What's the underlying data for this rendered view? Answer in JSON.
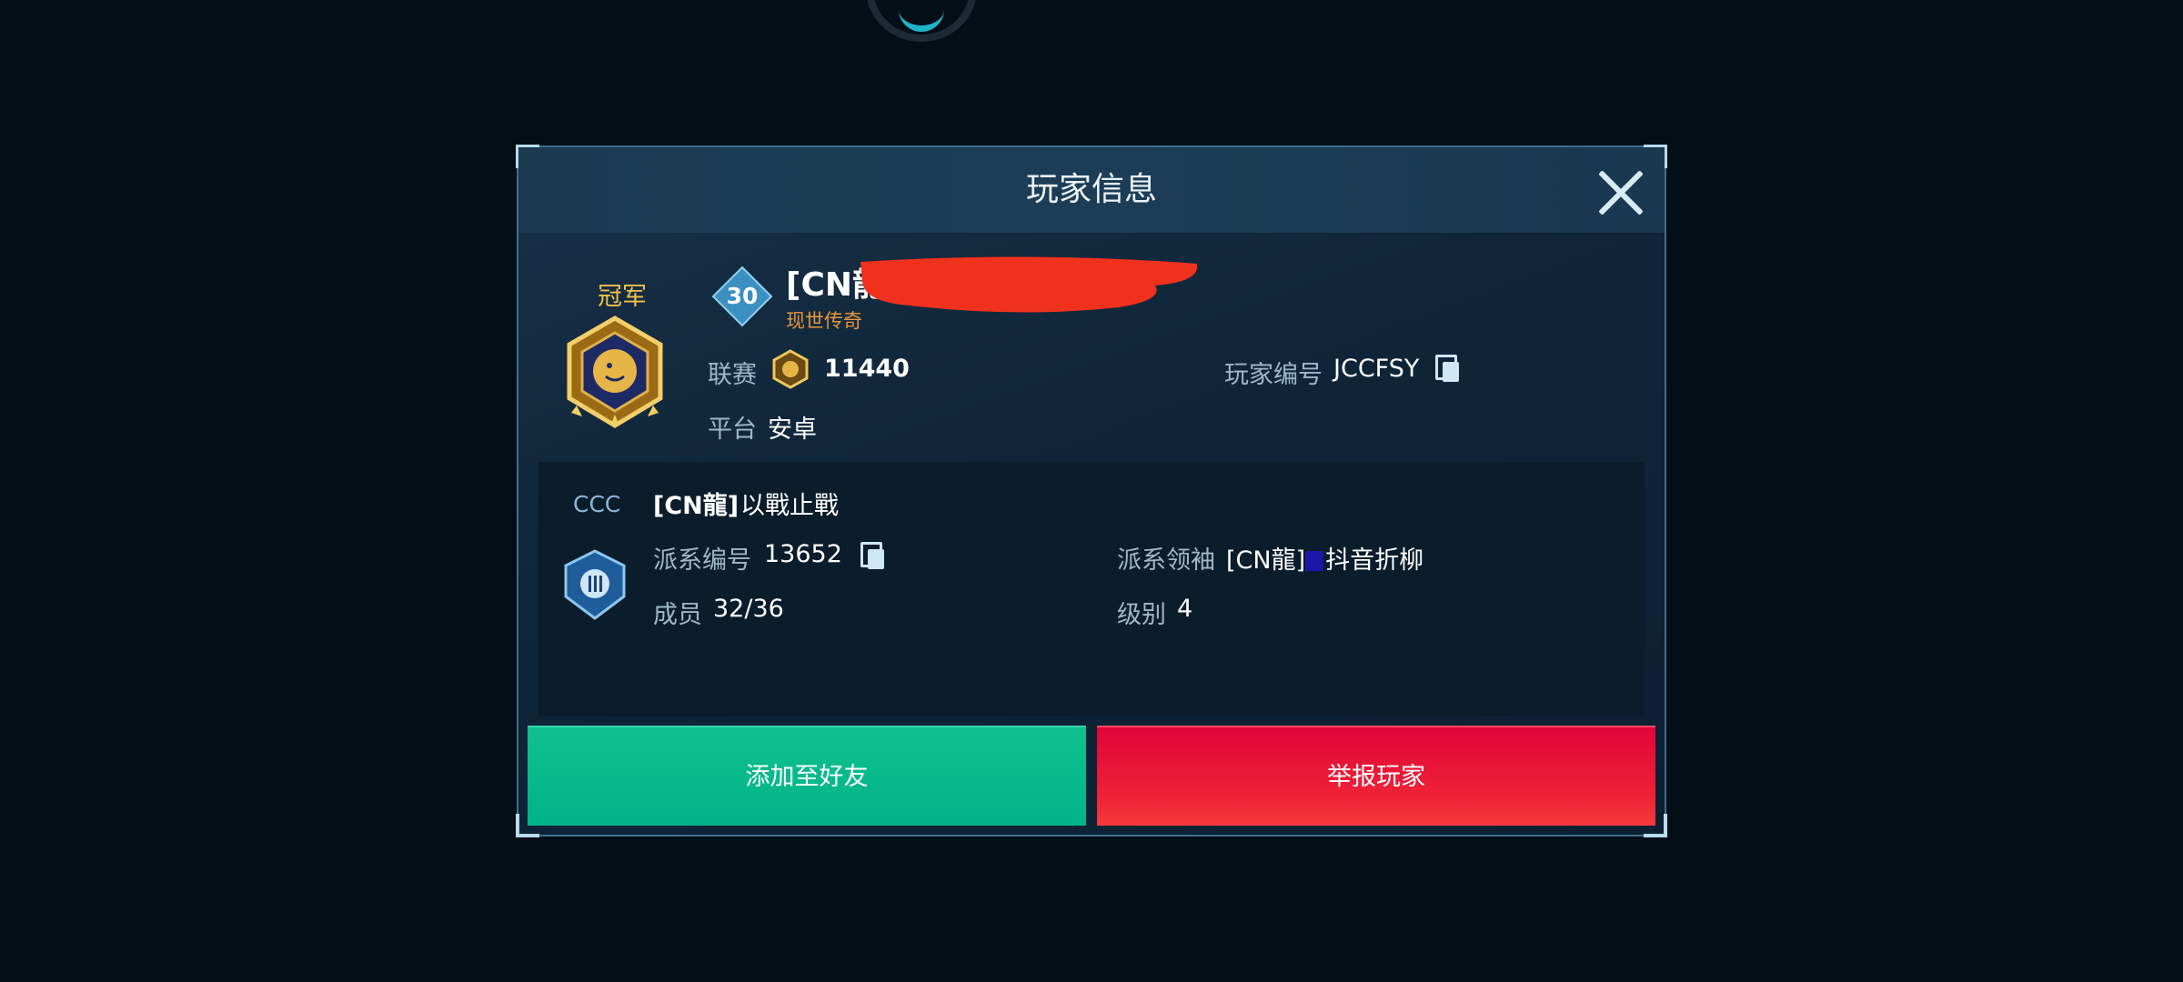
{
  "dialog": {
    "title": "玩家信息",
    "close_icon": "close-icon"
  },
  "player": {
    "rank_label": "冠军",
    "level": "30",
    "name_visible": "[CN龍",
    "title": "现世传奇",
    "league_label": "联赛",
    "league_points": "11440",
    "platform_label": "平台",
    "platform_value": "安卓",
    "id_label": "玩家编号",
    "id_value": "JCCFSY"
  },
  "faction": {
    "tag": "CCC",
    "name_prefix": "[CN龍]",
    "name": "以戰止戰",
    "id_label": "派系编号",
    "id_value": "13652",
    "members_label": "成员",
    "members_value": "32/36",
    "leader_label": "派系领袖",
    "leader_prefix": "[CN龍]",
    "leader_name": "抖音折柳",
    "level_label": "级别",
    "level_value": "4"
  },
  "buttons": {
    "add_friend": "添加至好友",
    "report": "举报玩家"
  },
  "colors": {
    "accent_green": "#00b389",
    "accent_red": "#ea0b3a",
    "gold": "#f2c14a",
    "title_orange": "#e8973a"
  }
}
